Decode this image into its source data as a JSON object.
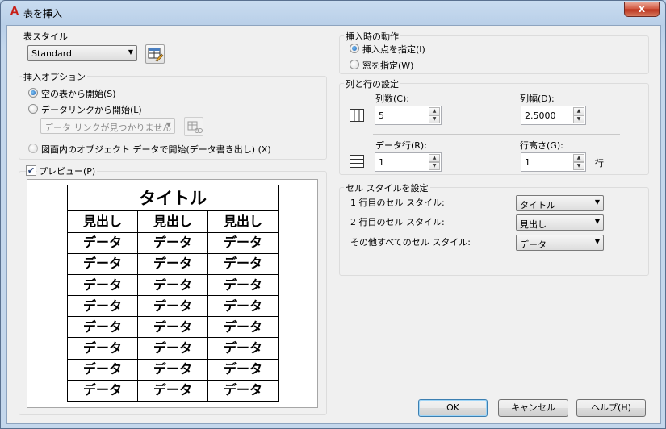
{
  "window": {
    "title": "表を挿入",
    "app_icon": "A",
    "close_glyph": "x"
  },
  "table_style": {
    "group_label": "表スタイル",
    "selected": "Standard",
    "launch_icon": "table-style-dialog-icon"
  },
  "insert_options": {
    "group_label": "挿入オプション",
    "empty_table": "空の表から開始(S)",
    "data_link": "データリンクから開始(L)",
    "data_link_combo": "データ リンクが見つかりません",
    "drawing_data": "図面内のオブジェクト データで開始(データ書き出し) (X)",
    "selected": "empty_table"
  },
  "preview": {
    "label": "プレビュー(P)",
    "checked": true,
    "title": "タイトル",
    "header": "見出し",
    "data": "データ",
    "columns": 3,
    "data_rows": 8
  },
  "insertion_behavior": {
    "group_label": "挿入時の動作",
    "insertion_point": "挿入点を指定(I)",
    "window": "窓を指定(W)",
    "selected": "insertion_point"
  },
  "column_row_settings": {
    "group_label": "列と行の設定",
    "columns_label": "列数(C):",
    "columns_value": "5",
    "column_width_label": "列幅(D):",
    "column_width_value": "2.5000",
    "data_rows_label": "データ行(R):",
    "data_rows_value": "1",
    "row_height_label": "行高さ(G):",
    "row_height_value": "1",
    "row_height_unit": "行"
  },
  "cell_styles": {
    "group_label": "セル スタイルを設定",
    "first_row_label": "1 行目のセル スタイル:",
    "first_row_value": "タイトル",
    "second_row_label": "2 行目のセル スタイル:",
    "second_row_value": "見出し",
    "other_rows_label": "その他すべてのセル スタイル:",
    "other_rows_value": "データ"
  },
  "buttons": {
    "ok": "OK",
    "cancel": "キャンセル",
    "help": "ヘルプ(H)"
  },
  "colors": {
    "frame": "#bcd3ea",
    "client": "#f0f0f0",
    "close_red": "#c8432b",
    "app_icon_red": "#c81d14"
  }
}
